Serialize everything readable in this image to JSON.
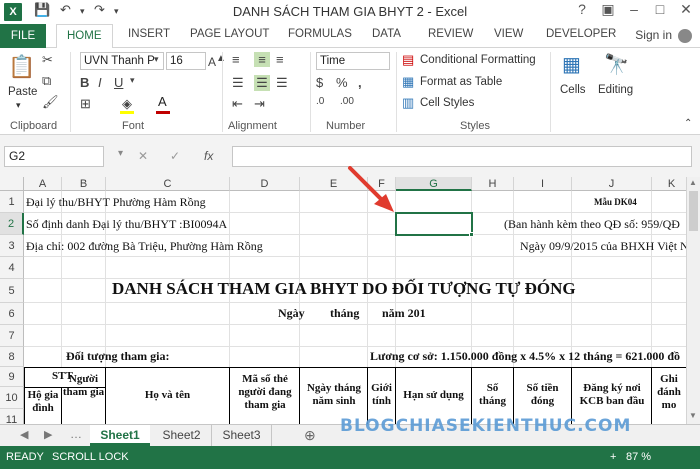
{
  "window": {
    "title": "DANH SÁCH THAM GIA BHYT 2 - Excel",
    "sign_in": "Sign in"
  },
  "tabs": [
    "FILE",
    "HOME",
    "INSERT",
    "PAGE LAYOUT",
    "FORMULAS",
    "DATA",
    "REVIEW",
    "VIEW",
    "DEVELOPER"
  ],
  "ribbon": {
    "clipboard": {
      "paste": "Paste",
      "label": "Clipboard"
    },
    "font": {
      "name": "UVN Thanh P",
      "size": "16",
      "label": "Font"
    },
    "alignment": {
      "label": "Alignment"
    },
    "number": {
      "format": "Time",
      "label": "Number"
    },
    "styles": {
      "conditional": "Conditional Formatting",
      "format_table": "Format as Table",
      "cell_styles": "Cell Styles",
      "label": "Styles"
    },
    "cells": "Cells",
    "editing": "Editing"
  },
  "formula_bar": {
    "name_box": "G2",
    "fx": "fx",
    "formula": ""
  },
  "columns": [
    "A",
    "B",
    "C",
    "D",
    "E",
    "F",
    "G",
    "H",
    "I",
    "J",
    "K"
  ],
  "rows": [
    "1",
    "2",
    "3",
    "4",
    "5",
    "6",
    "7",
    "8",
    "9",
    "10",
    "11"
  ],
  "cells": {
    "r1_a": "Đại lý thu/BHYT Phường Hàm Rồng",
    "r1_j": "Mẫu DK04",
    "r2_a": "Số định danh Đại lý thu/BHYT :BI0094A",
    "r2_i": "(Ban hành kèm theo QĐ số: 959/QĐ",
    "r3_a": "Địa chỉ: 002 đường Bà Triệu, Phường Hàm Rồng",
    "r3_i": "Ngày 09/9/2015 của BHXH Việt N",
    "r5_title": "DANH SÁCH THAM GIA BHYT DO ĐỐI TƯỢNG TỰ ĐÓNG",
    "r6_ngay": "Ngày",
    "r6_thang": "tháng",
    "r6_nam": "năm 201",
    "r8_doituong": "Đối tượng tham gia:",
    "r8_luong": "Lương cơ sở: 1.150.000 đồng x 4.5% x 12 tháng = 621.000 đồ",
    "r9_stt": "STT",
    "hdr_hogia": "Hộ gia đình",
    "hdr_nguoi": "Người tham gia",
    "hdr_hoten": "Họ và tên",
    "hdr_maso": "Mã số thẻ người đang tham gia",
    "hdr_ngaysinh": "Ngày tháng năm sinh",
    "hdr_gioitinh": "Giới tính",
    "hdr_hansd": "Hạn sử dụng",
    "hdr_sothang": "Số tháng",
    "hdr_sotien": "Số tiền đóng",
    "hdr_dangky": "Đăng ký nơi KCB ban đầu",
    "hdr_ghichu": "Ghi đánh mo"
  },
  "sheets": [
    "Sheet1",
    "Sheet2",
    "Sheet3"
  ],
  "status": {
    "ready": "READY",
    "scroll_lock": "SCROLL LOCK",
    "zoom": "87 %"
  },
  "watermark": "BLOGCHIASEKIENTHUC.COM"
}
